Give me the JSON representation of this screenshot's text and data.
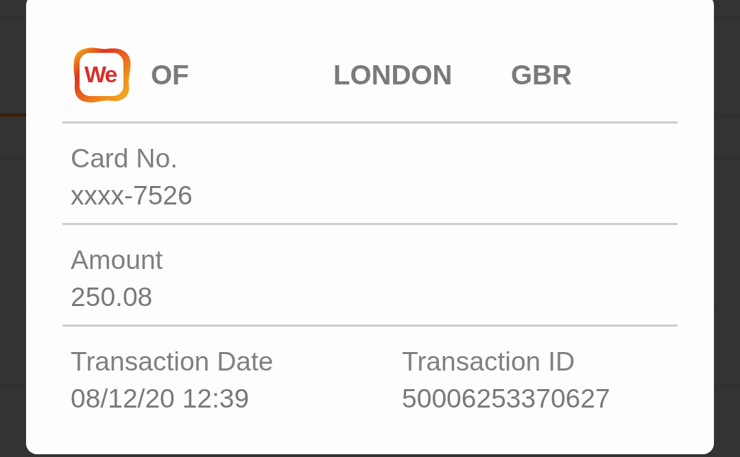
{
  "dialog": {
    "header": {
      "logo_text": "We",
      "merchant": "OF",
      "city": "LONDON",
      "country": "GBR"
    },
    "rows": [
      [
        {
          "label": "Card No.",
          "value": "xxxx-7526"
        }
      ],
      [
        {
          "label": "Amount",
          "value": "250.08"
        }
      ],
      [
        {
          "label": "Transaction Date",
          "value": "08/12/20 12:39"
        },
        {
          "label": "Transaction ID",
          "value": "50006253370627"
        }
      ]
    ]
  }
}
